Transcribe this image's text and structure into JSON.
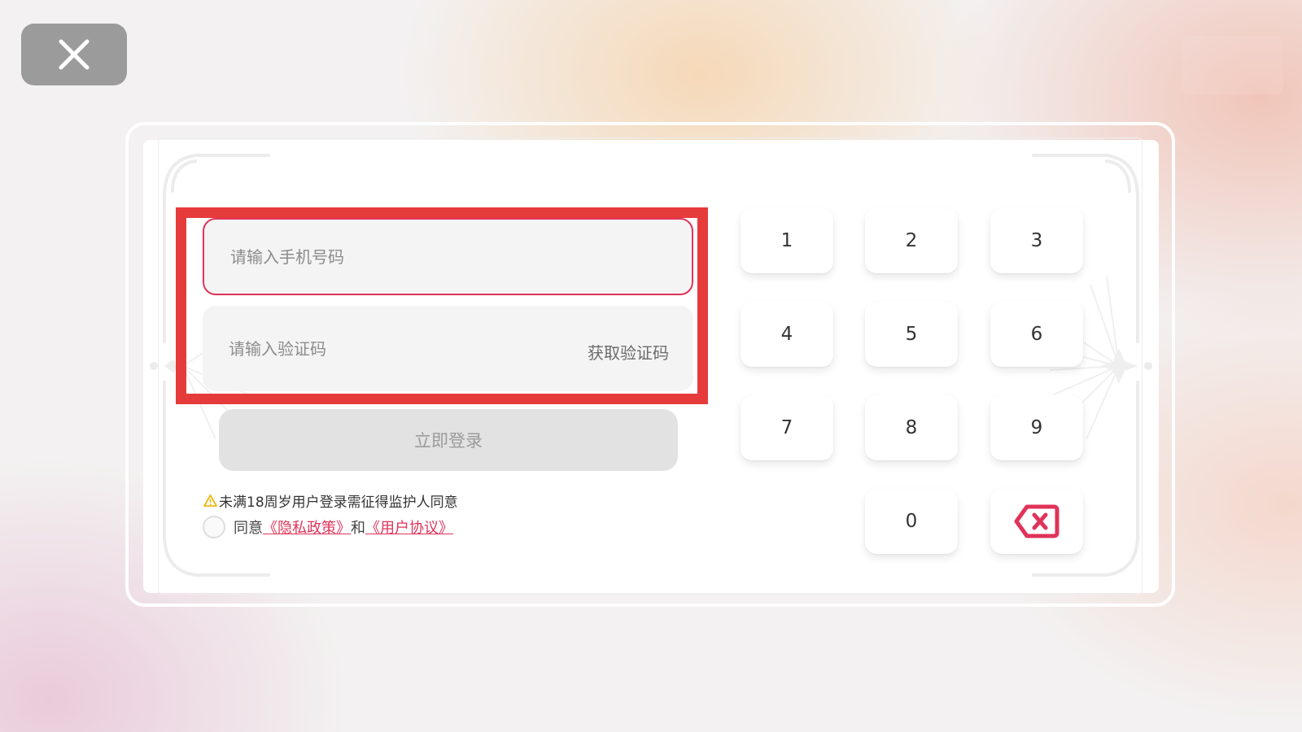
{
  "colors": {
    "accent": "#e0335a",
    "highlight_box": "#e63b3b",
    "warning": "#f0b400",
    "close_button_bg": "#9b9b9b",
    "login_button_bg": "#e2e2e2"
  },
  "icons": {
    "close": "close-icon",
    "warning": "warning-icon",
    "backspace": "backspace-icon"
  },
  "form": {
    "phone_placeholder": "请输入手机号码",
    "phone_value": "",
    "code_placeholder": "请输入验证码",
    "code_value": "",
    "get_code_label": "获取验证码",
    "login_label": "立即登录"
  },
  "notice": {
    "text": "未满18周岁用户登录需征得监护人同意"
  },
  "agreement": {
    "agree_text": "同意",
    "privacy_link": "《隐私政策》",
    "and_text": "和",
    "user_link": "《用户协议》"
  },
  "keypad": {
    "keys": [
      "1",
      "2",
      "3",
      "4",
      "5",
      "6",
      "7",
      "8",
      "9",
      "0"
    ]
  }
}
